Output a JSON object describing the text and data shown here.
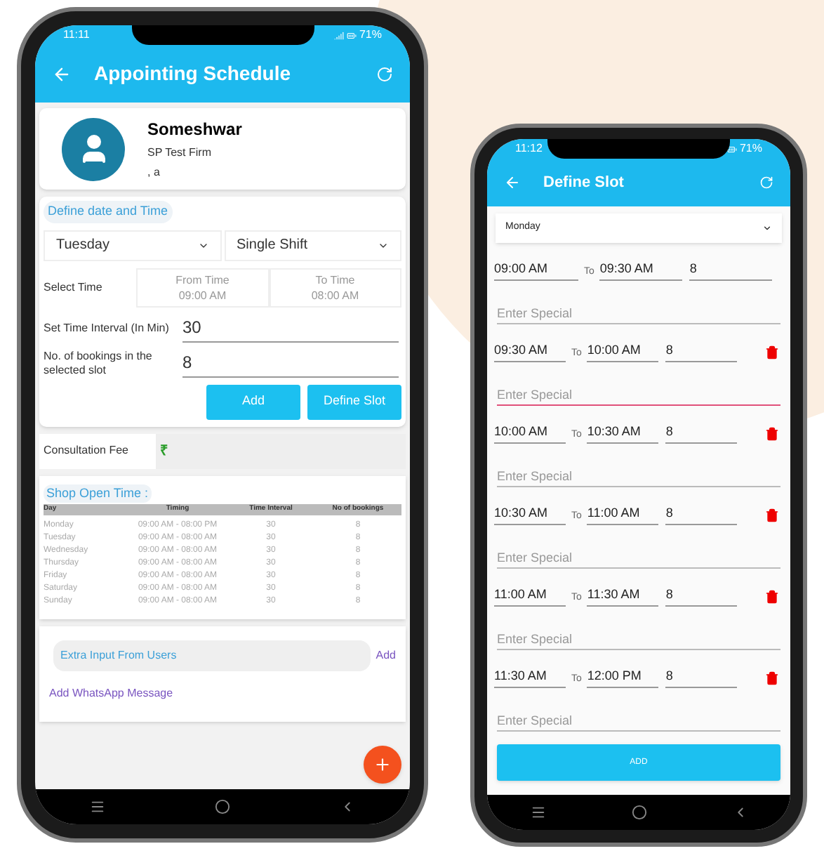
{
  "schedule_screen": {
    "status": {
      "time": "11:11",
      "battery": "71%"
    },
    "title": "Appointing Schedule",
    "profile": {
      "name": "Someshwar",
      "firm": "SP Test Firm",
      "address": ", a"
    },
    "section_label": "Define date and Time",
    "day_select": "Tuesday",
    "shift_select": "Single Shift",
    "select_time": {
      "label": "Select Time",
      "from": {
        "label": "From Time",
        "value": "09:00 AM"
      },
      "to": {
        "label": "To Time",
        "value": "08:00 AM"
      }
    },
    "interval": {
      "label": "Set Time Interval (In Min)",
      "value": "30"
    },
    "bookings": {
      "label": "No. of bookings in the selected slot",
      "value": "8"
    },
    "buttons": [
      "Add",
      "Define Slot"
    ],
    "fee": {
      "label": "Consultation Fee",
      "currency": "₹"
    },
    "open_time": {
      "label": "Shop Open Time :",
      "columns": [
        "Day",
        "Timing",
        "Time Interval",
        "No of bookings"
      ],
      "rows": [
        [
          "Monday",
          "09:00 AM - 08:00 PM",
          "30",
          "8"
        ],
        [
          "Tuesday",
          "09:00 AM - 08:00 AM",
          "30",
          "8"
        ],
        [
          "Wednesday",
          "09:00 AM - 08:00 AM",
          "30",
          "8"
        ],
        [
          "Thursday",
          "09:00 AM - 08:00 AM",
          "30",
          "8"
        ],
        [
          "Friday",
          "09:00 AM - 08:00 AM",
          "30",
          "8"
        ],
        [
          "Saturday",
          "09:00 AM - 08:00 AM",
          "30",
          "8"
        ],
        [
          "Sunday",
          "09:00 AM - 08:00 AM",
          "30",
          "8"
        ]
      ]
    },
    "extra_input": {
      "label": "Extra Input From Users",
      "action": "Add"
    },
    "whatsapp_link": "Add WhatsApp Message"
  },
  "slot_screen": {
    "status": {
      "time": "11:12",
      "battery": "71%"
    },
    "title": "Define Slot",
    "day_select": "Monday",
    "slots": [
      {
        "from": "09:00 AM",
        "to_label": "To",
        "to": "09:30 AM",
        "count": "8",
        "deletable": false,
        "special": {
          "placeholder": "Enter Special",
          "focused": false
        }
      },
      {
        "from": "09:30 AM",
        "to_label": "To",
        "to": "10:00 AM",
        "count": "8",
        "deletable": true,
        "special": {
          "placeholder": "Enter Special",
          "focused": true
        }
      },
      {
        "from": "10:00 AM",
        "to_label": "To",
        "to": "10:30 AM",
        "count": "8",
        "deletable": true,
        "special": {
          "placeholder": "Enter Special",
          "focused": false
        }
      },
      {
        "from": "10:30 AM",
        "to_label": "To",
        "to": "11:00 AM",
        "count": "8",
        "deletable": true,
        "special": {
          "placeholder": "Enter Special",
          "focused": false
        }
      },
      {
        "from": "11:00 AM",
        "to_label": "To",
        "to": "11:30 AM",
        "count": "8",
        "deletable": true,
        "special": {
          "placeholder": "Enter Special",
          "focused": false
        }
      },
      {
        "from": "11:30 AM",
        "to_label": "To",
        "to": "12:00 PM",
        "count": "8",
        "deletable": true,
        "special": {
          "placeholder": "Enter Special",
          "focused": false
        }
      }
    ],
    "add_button": "ADD"
  }
}
